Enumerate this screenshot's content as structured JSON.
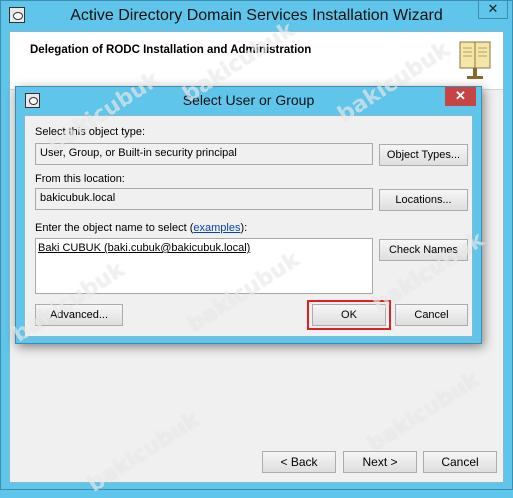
{
  "wizard": {
    "title": "Active Directory Domain Services Installation Wizard",
    "close_glyph": "✕",
    "header_title": "Delegation of RODC Installation and Administration",
    "back_label": "< Back",
    "next_label": "Next >",
    "cancel_label": "Cancel"
  },
  "dialog": {
    "title": "Select User or Group",
    "close_glyph": "✕",
    "object_type_label": "Select this object type:",
    "object_type_value": "User, Group, or Built-in security principal",
    "object_types_button": "Object Types...",
    "location_label": "From this location:",
    "location_value": "bakicubuk.local",
    "locations_button": "Locations...",
    "object_name_label_prefix": "Enter the object name to select (",
    "examples_link": "examples",
    "object_name_label_suffix": "):",
    "object_name_value": "Baki CUBUK (baki.cubuk@bakicubuk.local)",
    "check_names_button": "Check Names",
    "advanced_button": "Advanced...",
    "ok_button": "OK",
    "cancel_button": "Cancel"
  },
  "watermark": "bakicubuk",
  "colors": {
    "titlebar": "#5fc5ea",
    "close_active": "#c74444",
    "highlight": "#e02020"
  }
}
